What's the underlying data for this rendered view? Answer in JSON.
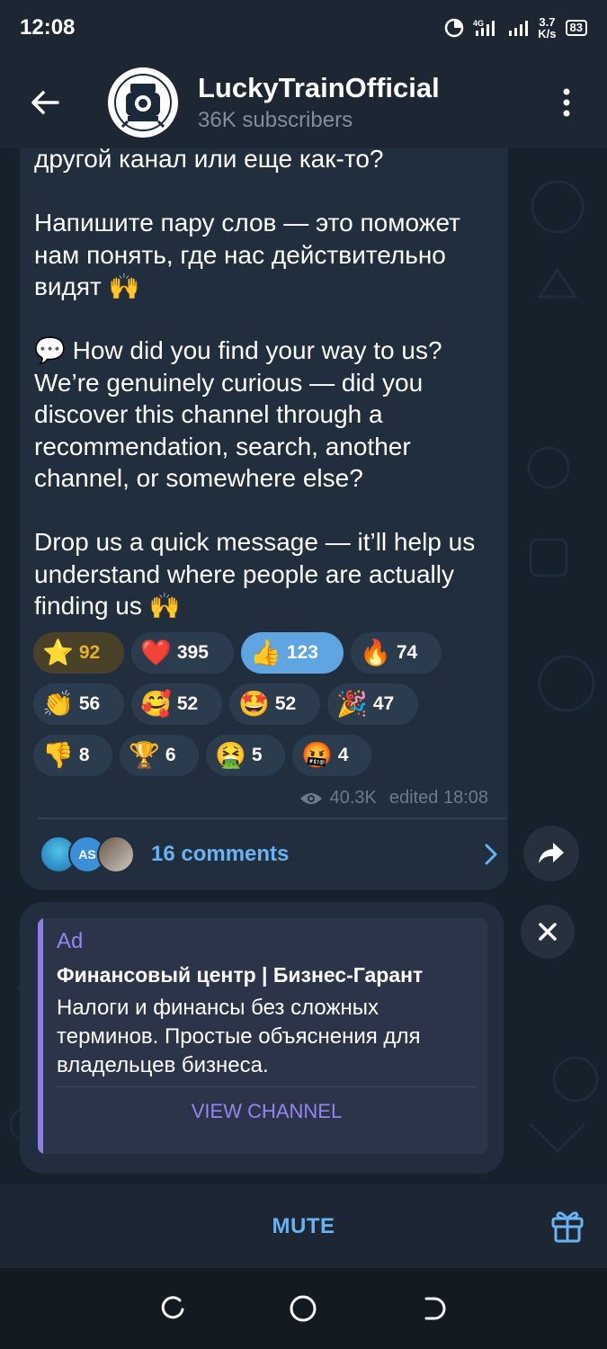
{
  "status_bar": {
    "time": "12:08",
    "network": "4G",
    "speed_value": "3.7",
    "speed_unit": "K/s",
    "battery": "83"
  },
  "header": {
    "channel_name": "LuckyTrainOfficial",
    "subscribers": "36K subscribers"
  },
  "message": {
    "text": "другой канал или еще как-то?\n\nНапишите пару слов — это поможет нам понять, где нас действительно видят 🙌\n\n💬 How did you find your way to us? We’re genuinely curious — did you discover this channel through a recommendation, search, another channel, or somewhere else?\n\nDrop us a quick message — it’ll help us understand where people are actually finding us 🙌",
    "views": "40.3K",
    "edited": "edited 18:08"
  },
  "reactions": [
    {
      "emoji": "⭐",
      "count": "92",
      "icon": "star-icon"
    },
    {
      "emoji": "❤️",
      "count": "395",
      "icon": "heart-icon"
    },
    {
      "emoji": "👍",
      "count": "123",
      "icon": "thumbs-up-icon"
    },
    {
      "emoji": "🔥",
      "count": "74",
      "icon": "fire-icon"
    },
    {
      "emoji": "👏",
      "count": "56",
      "icon": "clap-icon"
    },
    {
      "emoji": "🥰",
      "count": "52",
      "icon": "smiling-hearts-icon"
    },
    {
      "emoji": "🤩",
      "count": "52",
      "icon": "star-struck-icon"
    },
    {
      "emoji": "🎉",
      "count": "47",
      "icon": "party-popper-icon"
    },
    {
      "emoji": "👎",
      "count": "8",
      "icon": "thumbs-down-icon"
    },
    {
      "emoji": "🏆",
      "count": "6",
      "icon": "trophy-icon"
    },
    {
      "emoji": "🤮",
      "count": "5",
      "icon": "vomit-icon"
    },
    {
      "emoji": "🤬",
      "count": "4",
      "icon": "cursing-icon"
    }
  ],
  "comments": {
    "label": "16 comments",
    "avatar_initials": "AS"
  },
  "ad": {
    "label": "Ad",
    "title": "Финансовый центр | Бизнес-Гарант",
    "description": "Налоги и финансы без сложных терминов. Простые объяснения для владельцев бизнеса.",
    "button": "VIEW CHANNEL"
  },
  "bottom": {
    "mute": "MUTE"
  },
  "colors": {
    "accent": "#6ab3f3",
    "ad_accent": "#8b7ee8",
    "bubble": "#212e3d",
    "header": "#1d2733"
  }
}
